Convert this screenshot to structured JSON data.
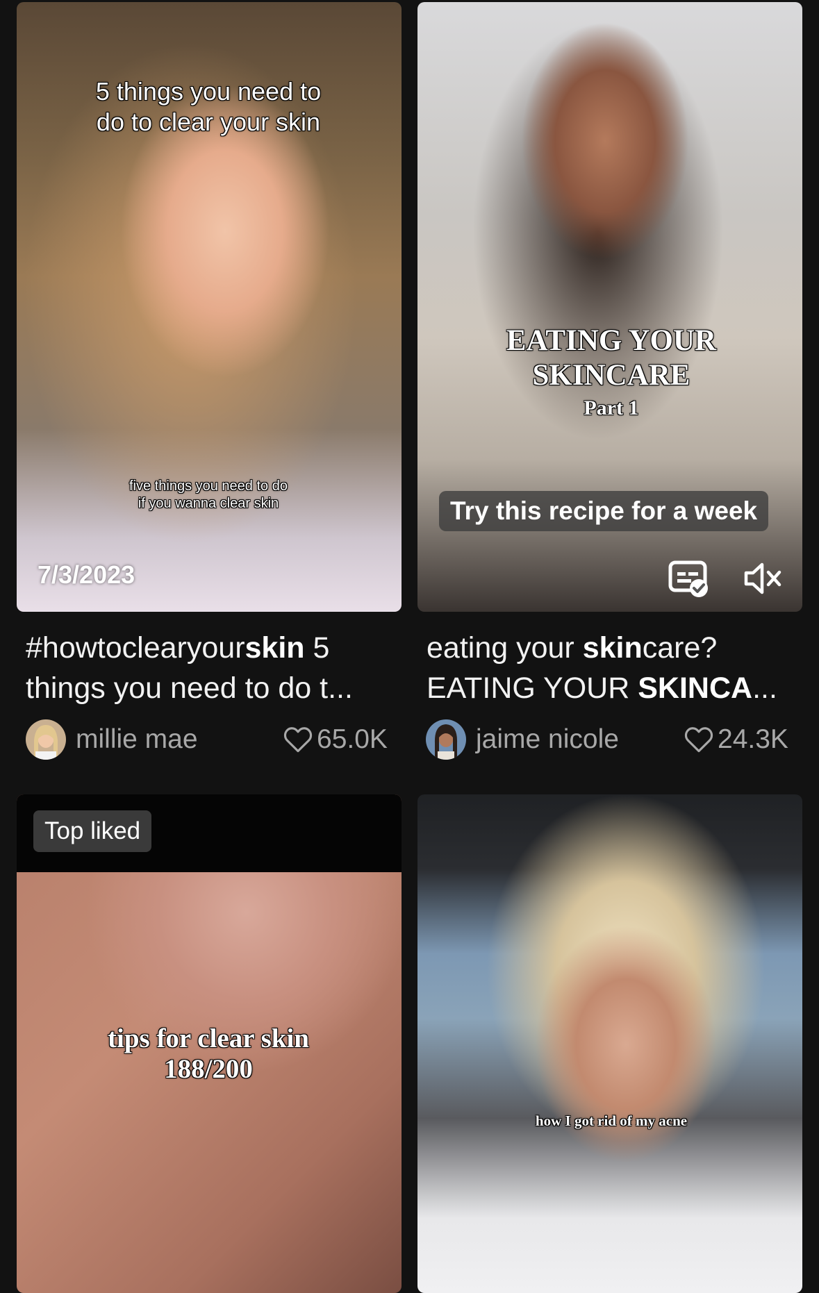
{
  "cards": [
    {
      "overlay_title_line1": "5 things you need to",
      "overlay_title_line2": "do to clear your skin",
      "overlay_sub_line1": "five things you need to do",
      "overlay_sub_line2": "if you wanna clear skin",
      "date": "7/3/2023",
      "caption_line1_hashtag_a": "#howtoclearyour",
      "caption_line1_hashtag_b": "skin",
      "caption_line1_rest": " 5",
      "caption_line2": "things you need to do t...",
      "author": "millie mae",
      "likes": "65.0K"
    },
    {
      "overlay_title_line1": "EATING YOUR",
      "overlay_title_line2": "SKINCARE",
      "overlay_title_line3": "Part 1",
      "overlay_pill": "Try this recipe for a week",
      "caption_line1_a": " eating your ",
      "caption_line1_b": "skin",
      "caption_line1_c": "care?",
      "caption_line2_a": "EATING YOUR ",
      "caption_line2_b": "SKINCA",
      "caption_line2_c": "...",
      "author": "jaime nicole",
      "likes": "24.3K"
    },
    {
      "badge": "Top liked",
      "overlay_line1": "tips for clear skin",
      "overlay_line2": "188/200"
    },
    {
      "overlay_line1": "how I got rid of my acne"
    }
  ],
  "icons": {
    "captions": "captions-icon",
    "mute": "mute-icon",
    "heart": "heart-icon"
  }
}
